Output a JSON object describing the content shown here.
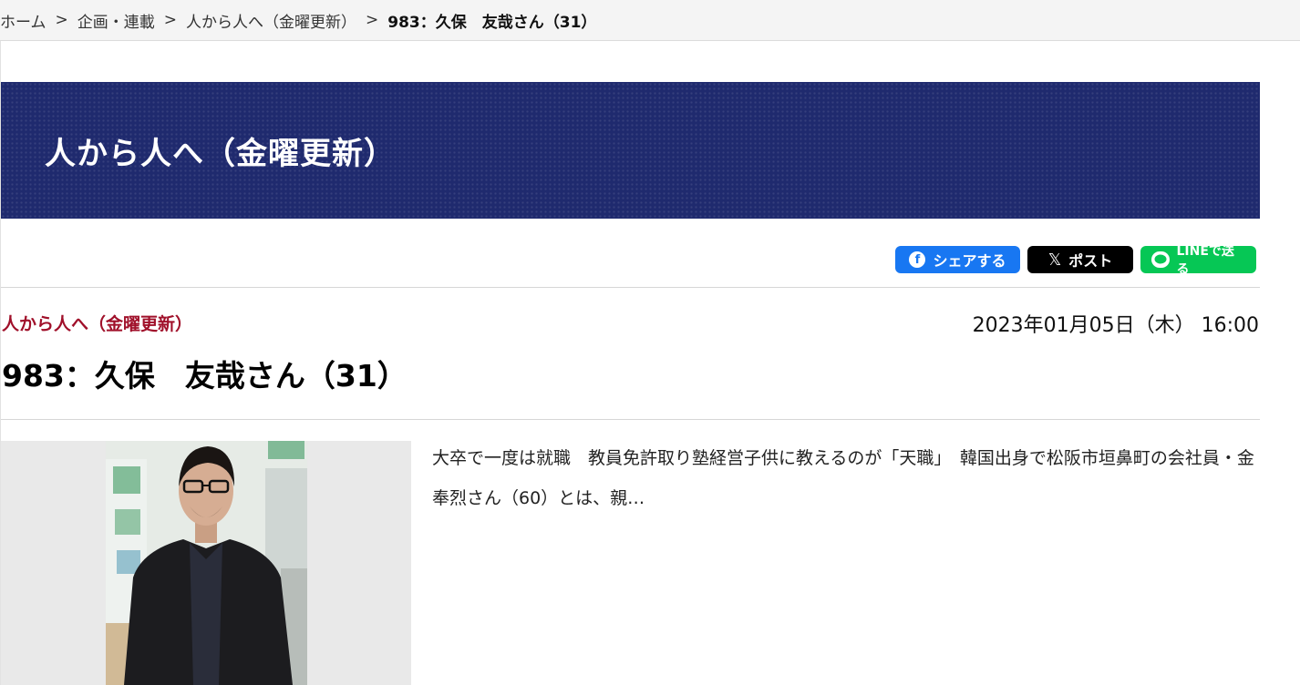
{
  "breadcrumb": {
    "items": [
      "ホーム",
      "企画・連載",
      "人から人へ（金曜更新）"
    ],
    "current": "983：久保　友哉さん（31）",
    "separator": ">"
  },
  "banner": {
    "title": "人から人へ（金曜更新）",
    "color": "#1f2a6e"
  },
  "share": {
    "facebook_label": "シェアする",
    "x_label": "ポスト",
    "line_label": "LINEで送る",
    "facebook_icon": "facebook-icon",
    "x_icon": "x-logo-icon",
    "line_icon": "line-icon",
    "colors": {
      "facebook": "#1877f2",
      "x": "#000000",
      "line": "#06c755"
    }
  },
  "article": {
    "category": "人から人へ（金曜更新）",
    "category_color": "#a0102a",
    "date": "2023年01月05日（木） 16:00",
    "title": "983：久保　友哉さん（31）",
    "excerpt": "大卒で一度は就職　教員免許取り塾経営子供に教えるのが「天職」　韓国出身で松阪市垣鼻町の会社員・金奉烈さん（60）とは、親…"
  }
}
